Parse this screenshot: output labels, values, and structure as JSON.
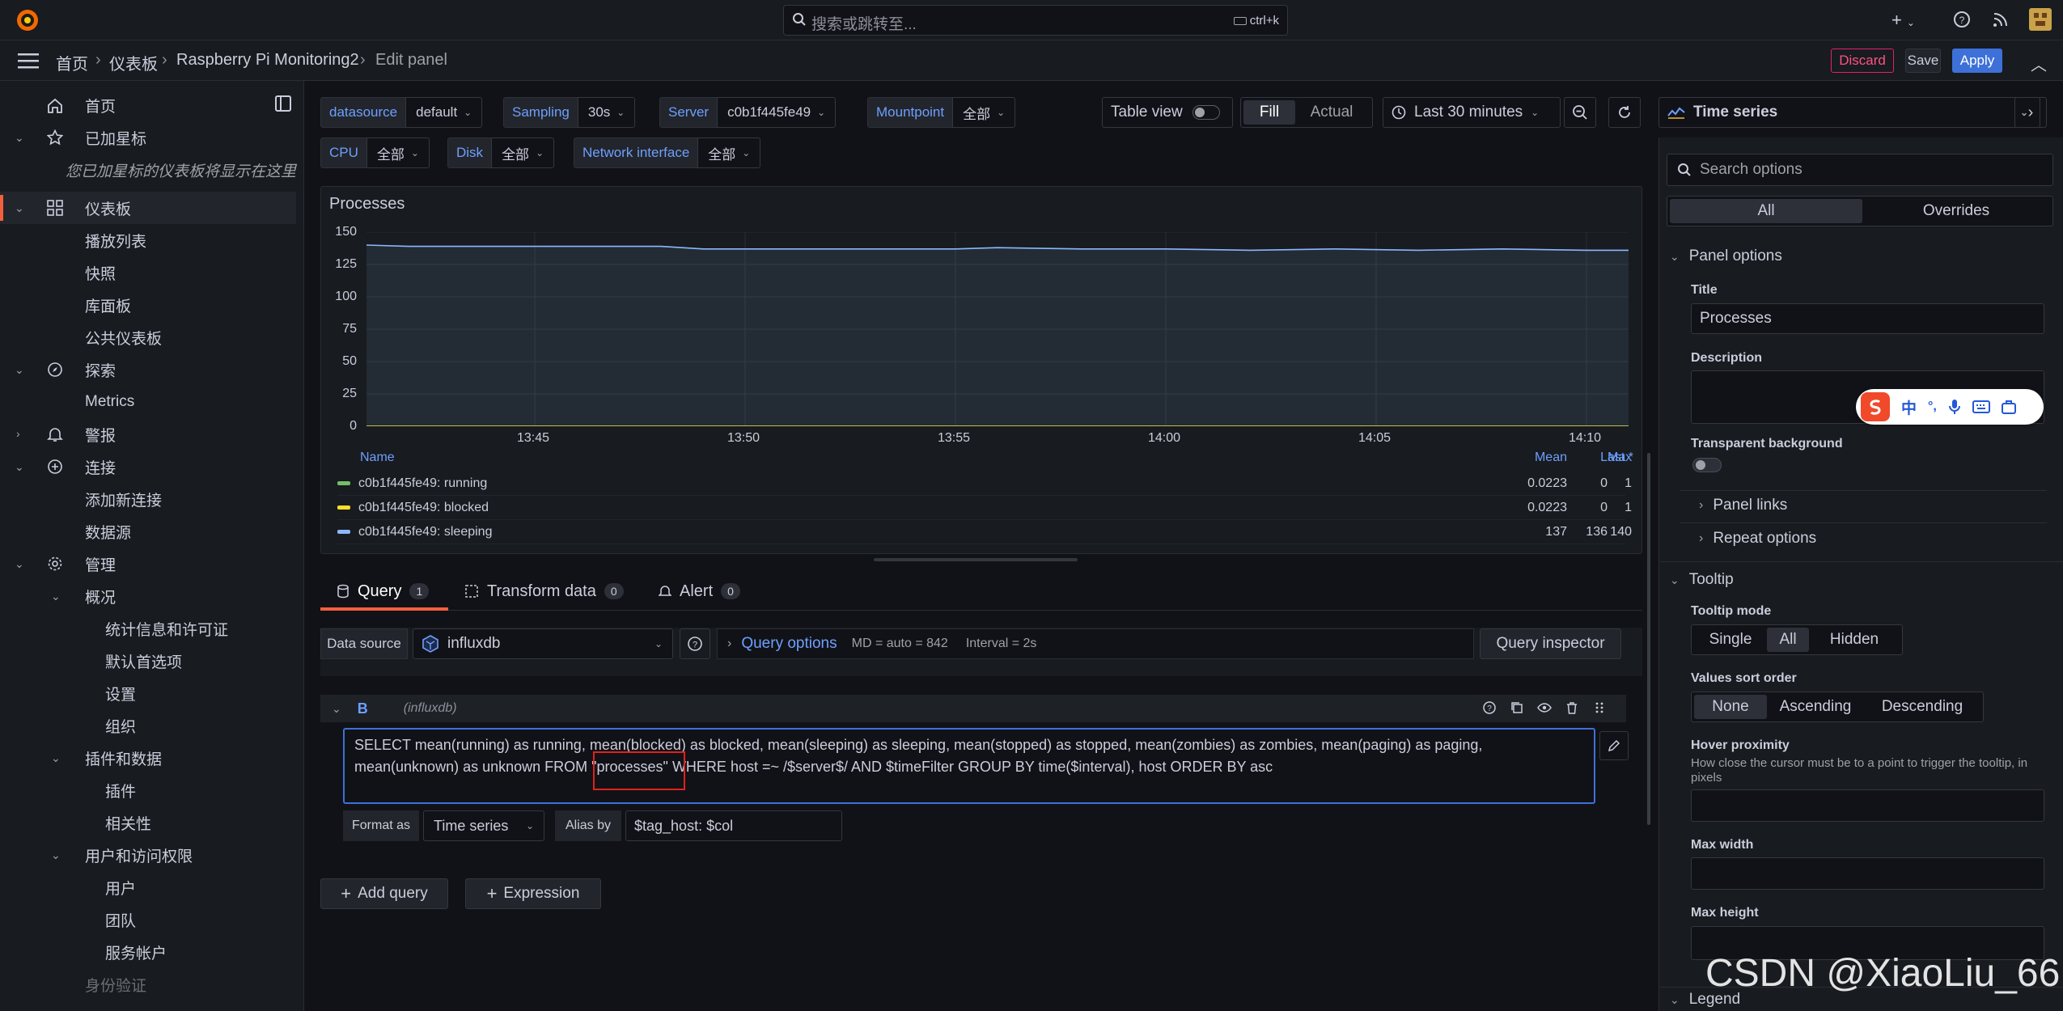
{
  "topbar": {
    "search_placeholder": "搜索或跳转至...",
    "search_shortcut": "ctrl+k",
    "new_label": "+"
  },
  "breadcrumb": [
    "首页",
    "仪表板",
    "Raspberry Pi Monitoring2",
    "Edit panel"
  ],
  "actions": {
    "discard": "Discard",
    "save": "Save",
    "apply": "Apply"
  },
  "sidebar": {
    "items": [
      {
        "label": "首页",
        "icon": "home-icon",
        "level": 0
      },
      {
        "label": "已加星标",
        "icon": "star-icon",
        "level": 0,
        "chevron": "down"
      },
      {
        "label": "您已加星标的仪表板将显示在这里",
        "level": 1,
        "italic": true
      },
      {
        "label": "仪表板",
        "icon": "dashboards-icon",
        "level": 0,
        "chevron": "down",
        "active": true
      },
      {
        "label": "播放列表",
        "level": 1
      },
      {
        "label": "快照",
        "level": 1
      },
      {
        "label": "库面板",
        "level": 1
      },
      {
        "label": "公共仪表板",
        "level": 1
      },
      {
        "label": "探索",
        "icon": "compass-icon",
        "level": 0,
        "chevron": "down"
      },
      {
        "label": "Metrics",
        "level": 1
      },
      {
        "label": "警报",
        "icon": "bell-icon",
        "level": 0,
        "chevron": "right"
      },
      {
        "label": "连接",
        "icon": "link-icon",
        "level": 0,
        "chevron": "down"
      },
      {
        "label": "添加新连接",
        "level": 1
      },
      {
        "label": "数据源",
        "level": 1
      },
      {
        "label": "管理",
        "icon": "cog-icon",
        "level": 0,
        "chevron": "down"
      },
      {
        "label": "概况",
        "level": 1,
        "chevron": "down"
      },
      {
        "label": "统计信息和许可证",
        "level": 2
      },
      {
        "label": "默认首选项",
        "level": 2
      },
      {
        "label": "设置",
        "level": 2
      },
      {
        "label": "组织",
        "level": 2
      },
      {
        "label": "插件和数据",
        "level": 1,
        "chevron": "down"
      },
      {
        "label": "插件",
        "level": 2
      },
      {
        "label": "相关性",
        "level": 2
      },
      {
        "label": "用户和访问权限",
        "level": 1,
        "chevron": "down"
      },
      {
        "label": "用户",
        "level": 2
      },
      {
        "label": "团队",
        "level": 2
      },
      {
        "label": "服务帐户",
        "level": 2
      },
      {
        "label": "身份验证",
        "level": 1,
        "faded": true
      }
    ]
  },
  "variables": [
    {
      "label": "datasource",
      "value": "default"
    },
    {
      "label": "Sampling",
      "value": "30s"
    },
    {
      "label": "Server",
      "value": "c0b1f445fe49"
    },
    {
      "label": "Mountpoint",
      "value": "全部"
    },
    {
      "label": "CPU",
      "value": "全部"
    },
    {
      "label": "Disk",
      "value": "全部"
    },
    {
      "label": "Network interface",
      "value": "全部"
    }
  ],
  "view_controls": {
    "table_view": "Table view",
    "fill": "Fill",
    "actual": "Actual",
    "time_range": "Last 30 minutes"
  },
  "panel": {
    "title": "Processes",
    "legend_headers": {
      "name": "Name",
      "mean": "Mean",
      "last": "Last *",
      "max": "Max"
    },
    "legend_rows": [
      {
        "name": "c0b1f445fe49: running",
        "color": "#73bf69",
        "mean": "0.0223",
        "last": "0",
        "max": "1"
      },
      {
        "name": "c0b1f445fe49: blocked",
        "color": "#fade2a",
        "mean": "0.0223",
        "last": "0",
        "max": "1"
      },
      {
        "name": "c0b1f445fe49: sleeping",
        "color": "#8ab8ff",
        "mean": "137",
        "last": "136",
        "max": "140"
      }
    ]
  },
  "chart_data": {
    "type": "line",
    "x_ticks": [
      "13:45",
      "13:50",
      "13:55",
      "14:00",
      "14:05",
      "14:10"
    ],
    "y_ticks": [
      "150",
      "125",
      "100",
      "75",
      "50",
      "25",
      "0"
    ],
    "ylim": [
      0,
      150
    ],
    "x_range": [
      "13:41",
      "14:11"
    ],
    "grid": true,
    "legend_placement": "bottom",
    "series": [
      {
        "name": "c0b1f445fe49: running",
        "color": "#73bf69",
        "x": [
          "13:41",
          "13:46",
          "13:51",
          "13:56",
          "14:01",
          "14:06",
          "14:11"
        ],
        "values": [
          0,
          0,
          0,
          0,
          0,
          0,
          0
        ]
      },
      {
        "name": "c0b1f445fe49: blocked",
        "color": "#fade2a",
        "x": [
          "13:41",
          "13:46",
          "13:51",
          "13:56",
          "14:01",
          "14:06",
          "14:11"
        ],
        "values": [
          0,
          0,
          0,
          0,
          0,
          0,
          0
        ]
      },
      {
        "name": "c0b1f445fe49: sleeping",
        "color": "#8ab8ff",
        "x": [
          "13:41",
          "13:42",
          "13:48",
          "13:49",
          "13:55",
          "13:56",
          "13:58",
          "14:00",
          "14:02",
          "14:04",
          "14:06",
          "14:08",
          "14:10",
          "14:11"
        ],
        "values": [
          140,
          139,
          139,
          137,
          137,
          138,
          137,
          137,
          136,
          137,
          136,
          137,
          136,
          136
        ]
      }
    ]
  },
  "query_tabs": [
    {
      "label": "Query",
      "count": "1"
    },
    {
      "label": "Transform data",
      "count": "0"
    },
    {
      "label": "Alert",
      "count": "0"
    }
  ],
  "query_bar": {
    "datasource_label": "Data source",
    "datasource_value": "influxdb",
    "query_options": "Query options",
    "md_info": "MD = auto = 842",
    "interval_info": "Interval = 2s",
    "inspector": "Query inspector"
  },
  "query": {
    "ref": "B",
    "ds": "(influxdb)",
    "sql": "SELECT mean(running) as running, mean(blocked) as blocked, mean(sleeping) as sleeping, mean(stopped) as stopped, mean(zombies) as zombies, mean(paging) as paging, mean(unknown) as unknown FROM \"processes\" WHERE host =~ /$server$/ AND $timeFilter GROUP BY time($interval), host ORDER BY asc",
    "format_label": "Format as",
    "format_value": "Time series",
    "alias_label": "Alias by",
    "alias_value": "$tag_host: $col"
  },
  "bottom_buttons": {
    "add_query": "Add query",
    "expression": "Expression"
  },
  "options": {
    "viz": "Time series",
    "search_placeholder": "Search options",
    "tab_all": "All",
    "tab_overrides": "Overrides",
    "panel_options": "Panel options",
    "title_label": "Title",
    "title_value": "Processes",
    "description_label": "Description",
    "transparent_label": "Transparent background",
    "panel_links": "Panel links",
    "repeat_options": "Repeat options",
    "tooltip": "Tooltip",
    "tooltip_mode_label": "Tooltip mode",
    "tooltip_modes": [
      "Single",
      "All",
      "Hidden"
    ],
    "sort_label": "Values sort order",
    "sort_modes": [
      "None",
      "Ascending",
      "Descending"
    ],
    "hover_label": "Hover proximity",
    "hover_desc": "How close the cursor must be to a point to trigger the tooltip, in pixels",
    "max_width_label": "Max width",
    "max_height_label": "Max height",
    "legend": "Legend"
  },
  "ime_toolbar": {
    "char1": "中",
    "char2": "°,"
  },
  "watermark": "CSDN @XiaoLiu_66"
}
